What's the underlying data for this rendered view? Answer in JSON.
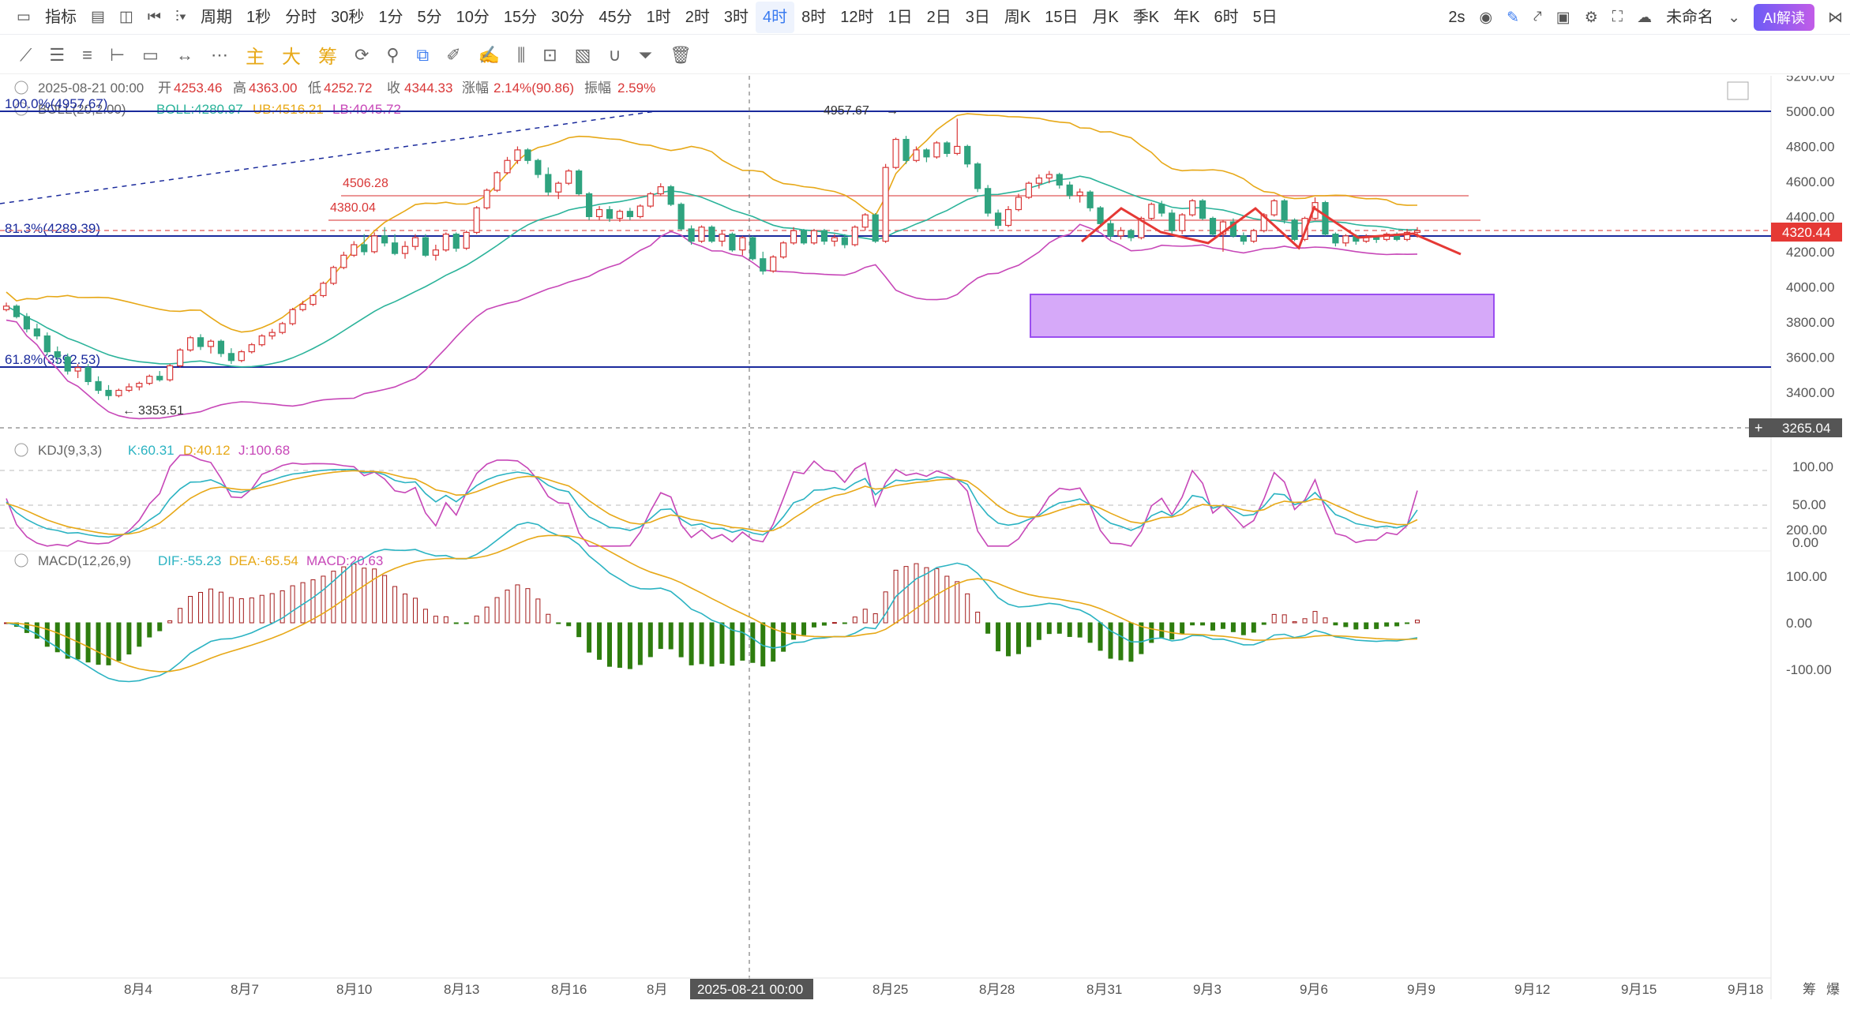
{
  "toolbar": {
    "items": [
      "指标",
      "周期",
      "1秒",
      "分时",
      "30秒",
      "1分",
      "5分",
      "10分",
      "15分",
      "30分",
      "45分",
      "1时",
      "2时",
      "3时",
      "4时",
      "8时",
      "12时",
      "1日",
      "2日",
      "3日",
      "周K",
      "15日",
      "月K",
      "季K",
      "年K",
      "6时",
      "5日"
    ],
    "active": "4时",
    "speed": "2s",
    "workspace": "未命名",
    "ai_label": "AI解读"
  },
  "drawing_toolbar": {
    "main_label": "主",
    "big_label": "大",
    "chip_label": "筹"
  },
  "colors": {
    "up": "#d93737",
    "down": "#2fa37f",
    "macd_pos": "#a31a1a",
    "macd_neg": "#2e7d0f",
    "boll_mid": "#2bb39a",
    "boll_ub": "#e7a817",
    "boll_lb": "#c747b8",
    "k": "#2bb3c2",
    "d": "#e7a817",
    "j": "#c747b8",
    "fib": "#1a2a9c",
    "range_box": "#b067f7",
    "arrow": "#e53935",
    "price_tag": "#e53935"
  },
  "main_panel": {
    "date_label": "2025-08-21 00:00",
    "open_label": "开",
    "open": "4253.46",
    "high_label": "高",
    "high": "4363.00",
    "low_label": "低",
    "low": "4252.72",
    "close_label": "收",
    "close": "4344.33",
    "change_label": "涨幅",
    "change": "2.14%(90.86)",
    "amp_label": "振幅",
    "amp": "2.59%",
    "boll_name": "BOLL(20,2.00)",
    "boll_val": "BOLL:4280.97",
    "ub_val": "UB:4516.21",
    "lb_val": "LB:4045.72",
    "fib_100": "100.0%(4957.67)",
    "fib_813": "81.3%(4289.39)",
    "fib_618": "61.8%(3592.53)",
    "level_a": "4506.28",
    "level_b": "4380.04",
    "high_marker": "4957.67",
    "low_marker": "3353.51",
    "last_price": "4320.44",
    "cursor_price": "3265.04",
    "y_ticks": [
      "5200.00",
      "5000.00",
      "4800.00",
      "4600.00",
      "4400.00",
      "4200.00",
      "4000.00",
      "3800.00",
      "3600.00",
      "3400.00"
    ]
  },
  "kdj_panel": {
    "name": "KDJ(9,3,3)",
    "k": "K:60.31",
    "d": "D:40.12",
    "j": "J:100.68",
    "y_ticks": [
      "100.00",
      "50.00",
      "0.00"
    ]
  },
  "macd_panel": {
    "name": "MACD(12,26,9)",
    "dif": "DIF:-55.23",
    "dea": "DEA:-65.54",
    "macd": "MACD:20.63",
    "y_ticks": [
      "200.00",
      "100.00",
      "0.00",
      "-100.00"
    ]
  },
  "x_axis": {
    "labels": [
      "8月4",
      "8月7",
      "8月10",
      "8月13",
      "8月16",
      "8月",
      "8月25",
      "8月28",
      "8月31",
      "9月3",
      "9月6",
      "9月9",
      "9月12",
      "9月15",
      "9月18"
    ],
    "crosshair_label": "2025-08-21 00:00",
    "right_labels": [
      "筹",
      "爆"
    ]
  },
  "chart_data": {
    "type": "candlestick",
    "interval": "4时",
    "candles": [
      [
        3870,
        3910,
        3860,
        3890
      ],
      [
        3890,
        3900,
        3820,
        3830
      ],
      [
        3830,
        3850,
        3740,
        3760
      ],
      [
        3760,
        3790,
        3700,
        3720
      ],
      [
        3720,
        3740,
        3610,
        3630
      ],
      [
        3630,
        3660,
        3560,
        3600
      ],
      [
        3600,
        3620,
        3500,
        3520
      ],
      [
        3520,
        3560,
        3480,
        3540
      ],
      [
        3540,
        3560,
        3440,
        3460
      ],
      [
        3460,
        3490,
        3390,
        3410
      ],
      [
        3410,
        3440,
        3355,
        3380
      ],
      [
        3380,
        3420,
        3370,
        3410
      ],
      [
        3410,
        3450,
        3400,
        3430
      ],
      [
        3430,
        3460,
        3410,
        3450
      ],
      [
        3450,
        3500,
        3440,
        3490
      ],
      [
        3490,
        3520,
        3460,
        3470
      ],
      [
        3470,
        3560,
        3460,
        3550
      ],
      [
        3550,
        3650,
        3540,
        3640
      ],
      [
        3640,
        3720,
        3630,
        3710
      ],
      [
        3710,
        3730,
        3640,
        3660
      ],
      [
        3660,
        3700,
        3620,
        3690
      ],
      [
        3690,
        3700,
        3600,
        3620
      ],
      [
        3620,
        3650,
        3560,
        3580
      ],
      [
        3580,
        3640,
        3570,
        3630
      ],
      [
        3630,
        3680,
        3620,
        3670
      ],
      [
        3670,
        3730,
        3660,
        3720
      ],
      [
        3720,
        3760,
        3700,
        3740
      ],
      [
        3740,
        3800,
        3730,
        3790
      ],
      [
        3790,
        3880,
        3780,
        3870
      ],
      [
        3870,
        3920,
        3860,
        3900
      ],
      [
        3900,
        3960,
        3890,
        3950
      ],
      [
        3950,
        4030,
        3940,
        4020
      ],
      [
        4020,
        4120,
        4010,
        4110
      ],
      [
        4110,
        4200,
        4100,
        4180
      ],
      [
        4180,
        4260,
        4170,
        4240
      ],
      [
        4240,
        4300,
        4180,
        4200
      ],
      [
        4200,
        4310,
        4190,
        4290
      ],
      [
        4290,
        4340,
        4230,
        4250
      ],
      [
        4250,
        4300,
        4180,
        4190
      ],
      [
        4190,
        4260,
        4160,
        4230
      ],
      [
        4230,
        4300,
        4210,
        4280
      ],
      [
        4280,
        4300,
        4170,
        4180
      ],
      [
        4180,
        4240,
        4150,
        4210
      ],
      [
        4210,
        4310,
        4200,
        4300
      ],
      [
        4300,
        4310,
        4200,
        4220
      ],
      [
        4220,
        4320,
        4210,
        4310
      ],
      [
        4310,
        4460,
        4300,
        4450
      ],
      [
        4450,
        4560,
        4440,
        4550
      ],
      [
        4550,
        4660,
        4540,
        4650
      ],
      [
        4650,
        4740,
        4640,
        4720
      ],
      [
        4720,
        4800,
        4700,
        4780
      ],
      [
        4780,
        4790,
        4700,
        4720
      ],
      [
        4720,
        4730,
        4620,
        4640
      ],
      [
        4640,
        4680,
        4520,
        4540
      ],
      [
        4540,
        4600,
        4500,
        4590
      ],
      [
        4590,
        4670,
        4580,
        4660
      ],
      [
        4660,
        4670,
        4520,
        4530
      ],
      [
        4530,
        4540,
        4380,
        4400
      ],
      [
        4400,
        4460,
        4380,
        4440
      ],
      [
        4440,
        4460,
        4370,
        4390
      ],
      [
        4390,
        4440,
        4370,
        4430
      ],
      [
        4430,
        4450,
        4380,
        4400
      ],
      [
        4400,
        4470,
        4390,
        4460
      ],
      [
        4460,
        4540,
        4450,
        4530
      ],
      [
        4530,
        4590,
        4520,
        4570
      ],
      [
        4570,
        4580,
        4460,
        4470
      ],
      [
        4470,
        4480,
        4320,
        4330
      ],
      [
        4330,
        4350,
        4240,
        4260
      ],
      [
        4260,
        4350,
        4250,
        4340
      ],
      [
        4340,
        4350,
        4250,
        4260
      ],
      [
        4260,
        4320,
        4230,
        4300
      ],
      [
        4300,
        4310,
        4200,
        4210
      ],
      [
        4210,
        4290,
        4180,
        4280
      ],
      [
        4280,
        4290,
        4150,
        4160
      ],
      [
        4160,
        4200,
        4070,
        4090
      ],
      [
        4090,
        4180,
        4080,
        4170
      ],
      [
        4170,
        4260,
        4160,
        4250
      ],
      [
        4250,
        4340,
        4240,
        4320
      ],
      [
        4320,
        4330,
        4240,
        4250
      ],
      [
        4250,
        4330,
        4240,
        4320
      ],
      [
        4320,
        4330,
        4240,
        4260
      ],
      [
        4260,
        4300,
        4230,
        4280
      ],
      [
        4280,
        4300,
        4220,
        4240
      ],
      [
        4240,
        4350,
        4230,
        4340
      ],
      [
        4340,
        4420,
        4320,
        4410
      ],
      [
        4410,
        4420,
        4250,
        4260
      ],
      [
        4260,
        4700,
        4250,
        4680
      ],
      [
        4680,
        4850,
        4670,
        4840
      ],
      [
        4840,
        4860,
        4700,
        4720
      ],
      [
        4720,
        4800,
        4710,
        4780
      ],
      [
        4780,
        4790,
        4710,
        4740
      ],
      [
        4740,
        4830,
        4730,
        4820
      ],
      [
        4820,
        4830,
        4740,
        4760
      ],
      [
        4760,
        4958,
        4750,
        4800
      ],
      [
        4800,
        4810,
        4680,
        4700
      ],
      [
        4700,
        4710,
        4540,
        4560
      ],
      [
        4560,
        4580,
        4400,
        4420
      ],
      [
        4420,
        4440,
        4330,
        4350
      ],
      [
        4350,
        4460,
        4340,
        4440
      ],
      [
        4440,
        4530,
        4430,
        4510
      ],
      [
        4510,
        4600,
        4500,
        4590
      ],
      [
        4590,
        4640,
        4560,
        4620
      ],
      [
        4620,
        4660,
        4590,
        4640
      ],
      [
        4640,
        4650,
        4560,
        4580
      ],
      [
        4580,
        4600,
        4500,
        4520
      ],
      [
        4520,
        4560,
        4480,
        4540
      ],
      [
        4540,
        4550,
        4430,
        4450
      ],
      [
        4450,
        4460,
        4340,
        4360
      ],
      [
        4360,
        4380,
        4270,
        4290
      ],
      [
        4290,
        4340,
        4270,
        4320
      ],
      [
        4320,
        4330,
        4260,
        4280
      ],
      [
        4280,
        4400,
        4270,
        4390
      ],
      [
        4390,
        4480,
        4380,
        4470
      ],
      [
        4470,
        4490,
        4400,
        4420
      ],
      [
        4420,
        4440,
        4300,
        4320
      ],
      [
        4320,
        4420,
        4300,
        4410
      ],
      [
        4410,
        4500,
        4400,
        4490
      ],
      [
        4490,
        4500,
        4380,
        4390
      ],
      [
        4390,
        4400,
        4290,
        4300
      ],
      [
        4300,
        4380,
        4200,
        4370
      ],
      [
        4370,
        4390,
        4280,
        4290
      ],
      [
        4290,
        4310,
        4240,
        4260
      ],
      [
        4260,
        4330,
        4250,
        4320
      ],
      [
        4320,
        4420,
        4310,
        4410
      ],
      [
        4410,
        4500,
        4400,
        4490
      ],
      [
        4490,
        4500,
        4360,
        4380
      ],
      [
        4380,
        4390,
        4260,
        4270
      ],
      [
        4270,
        4400,
        4260,
        4390
      ],
      [
        4390,
        4510,
        4380,
        4480
      ],
      [
        4480,
        4490,
        4290,
        4300
      ],
      [
        4300,
        4310,
        4230,
        4250
      ],
      [
        4250,
        4300,
        4230,
        4290
      ],
      [
        4290,
        4300,
        4240,
        4260
      ],
      [
        4260,
        4300,
        4250,
        4280
      ],
      [
        4280,
        4290,
        4250,
        4270
      ],
      [
        4270,
        4310,
        4260,
        4300
      ],
      [
        4300,
        4310,
        4260,
        4270
      ],
      [
        4270,
        4330,
        4260,
        4310
      ],
      [
        4310,
        4340,
        4280,
        4320
      ]
    ]
  }
}
